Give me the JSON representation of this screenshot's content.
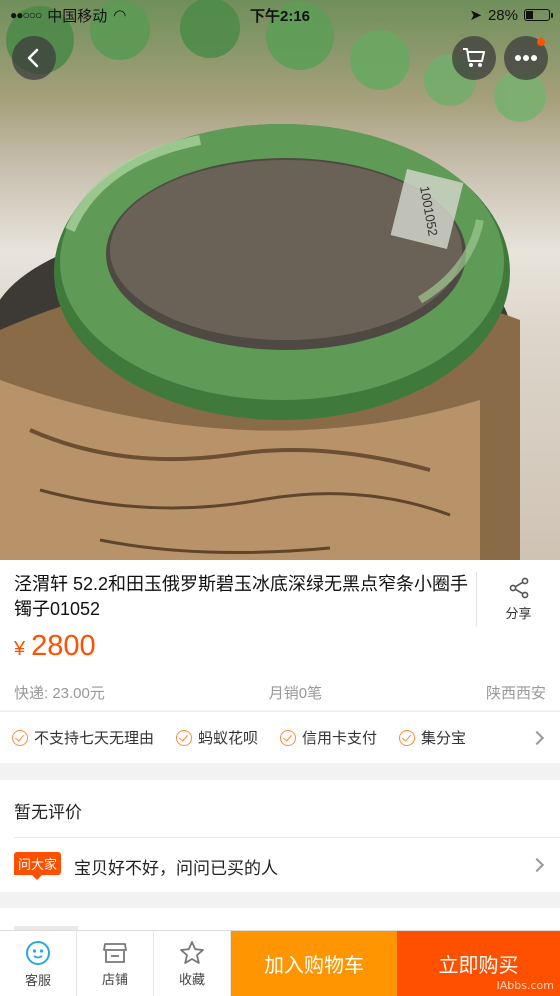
{
  "status_bar": {
    "carrier": "中国移动",
    "time": "下午2:16",
    "battery": "28%",
    "battery_level": 0.28
  },
  "header": {
    "back_icon": "chevron-left-icon",
    "cart_icon": "cart-icon",
    "more_icon": "more-dots-icon"
  },
  "product": {
    "title": "泾渭轩 52.2和田玉俄罗斯碧玉冰底深绿无黑点窄条小圈手镯子01052",
    "share_label": "分享",
    "currency": "¥",
    "price": "2800",
    "shipping": "快递: 23.00元",
    "monthly_sales": "月销0笔",
    "location": "陕西西安",
    "bangle_sticker": "1001052"
  },
  "services": [
    "不支持七天无理由",
    "蚂蚁花呗",
    "信用卡支付",
    "集分宝"
  ],
  "reviews": {
    "empty_text": "暂无评价",
    "ask_tag": "问大家",
    "ask_text": "宝贝好不好，问问已买的人"
  },
  "bottom_bar": {
    "service_label": "客服",
    "shop_label": "店铺",
    "favorite_label": "收藏",
    "add_cart_label": "加入购物车",
    "buy_now_label": "立即购买",
    "watermark": "IAbbs.com"
  },
  "colors": {
    "accent": "#ff5000",
    "cart_button": "#ff9500"
  }
}
